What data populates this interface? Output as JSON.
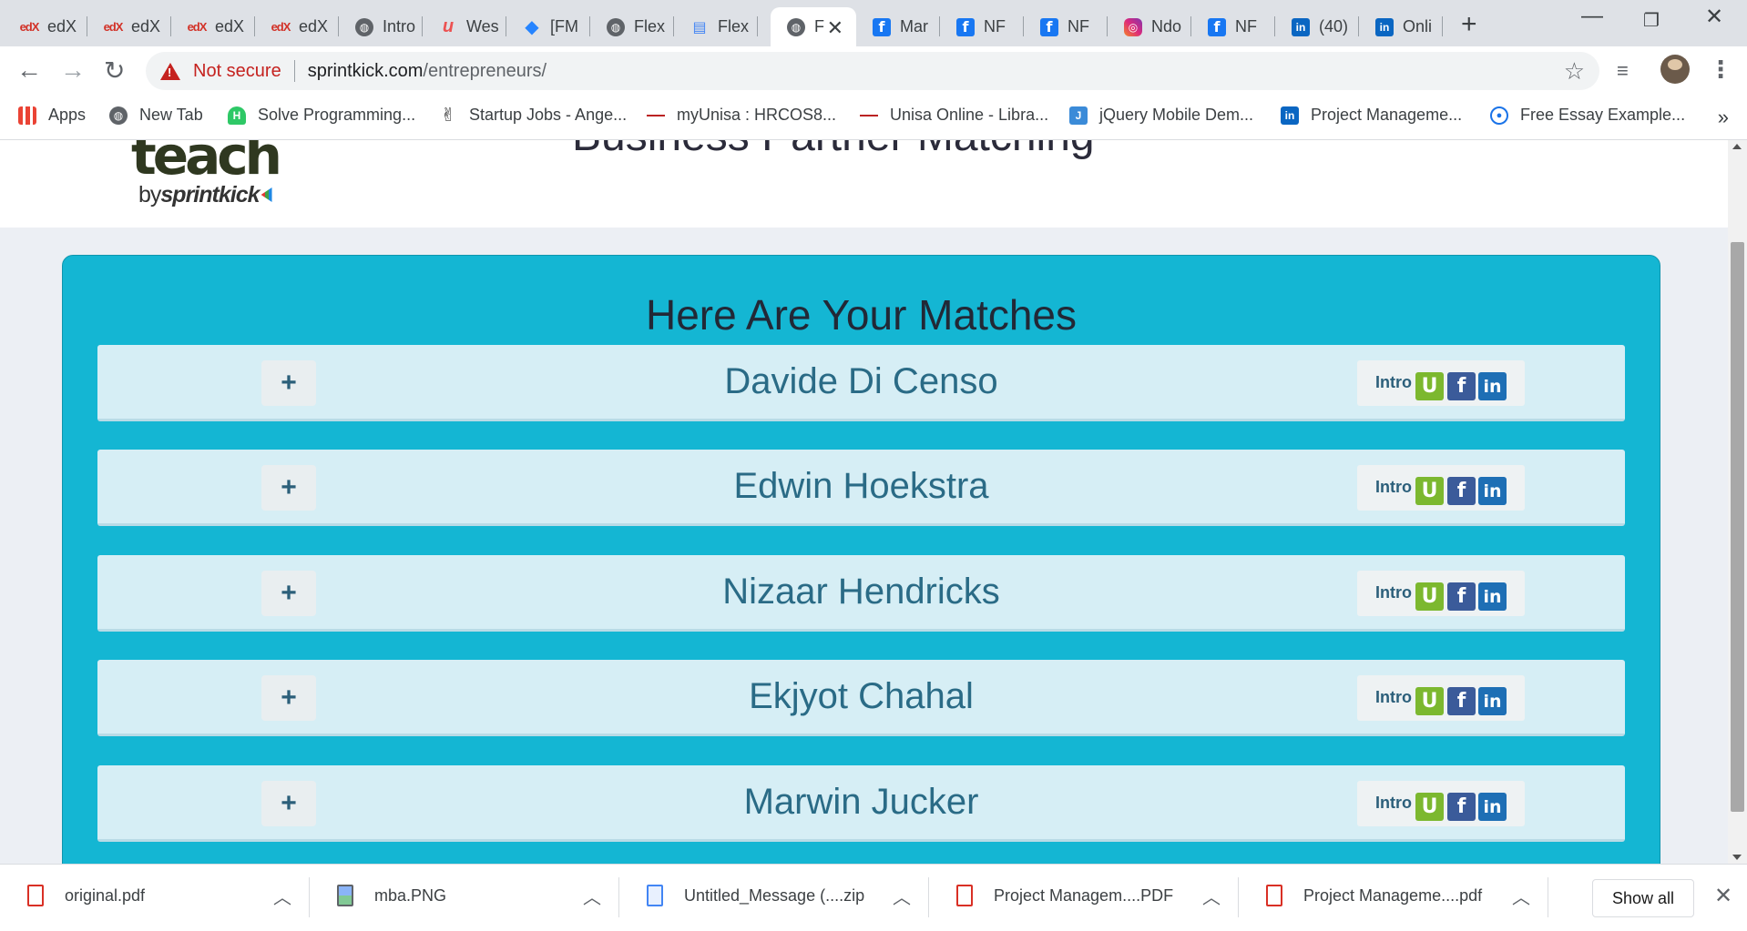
{
  "browser": {
    "tabs": [
      {
        "favicon": "edx-icon",
        "title": "edX"
      },
      {
        "favicon": "edx-icon",
        "title": "edX"
      },
      {
        "favicon": "edx-icon",
        "title": "edX"
      },
      {
        "favicon": "edx-icon",
        "title": "edX"
      },
      {
        "favicon": "globe-icon",
        "title": "Intro"
      },
      {
        "favicon": "udemy-icon",
        "title": "Wes"
      },
      {
        "favicon": "jira-icon",
        "title": "[FM"
      },
      {
        "favicon": "globe-icon",
        "title": "Flex"
      },
      {
        "favicon": "doc-icon",
        "title": "Flex"
      },
      {
        "favicon": "globe-icon",
        "title": "F",
        "active": true
      },
      {
        "favicon": "facebook-icon",
        "title": "Mar"
      },
      {
        "favicon": "facebook-icon",
        "title": "NF"
      },
      {
        "favicon": "facebook-icon",
        "title": "NF"
      },
      {
        "favicon": "instagram-icon",
        "title": "Ndo"
      },
      {
        "favicon": "facebook-icon",
        "title": "NF"
      },
      {
        "favicon": "linkedin-icon",
        "title": "(40)"
      },
      {
        "favicon": "linkedin-icon",
        "title": "Onli"
      }
    ],
    "security_label": "Not secure",
    "url_host": "sprintkick.com",
    "url_path": "/entrepreneurs/",
    "bookmarks": [
      {
        "icon": "apps-icon",
        "label": "Apps"
      },
      {
        "icon": "globe-icon",
        "label": "New Tab"
      },
      {
        "icon": "hackerrank-icon",
        "label": "Solve Programming..."
      },
      {
        "icon": "angellist-icon",
        "label": "Startup Jobs - Ange..."
      },
      {
        "icon": "unisa-icon",
        "label": "myUnisa : HRCOS8..."
      },
      {
        "icon": "unisa-icon",
        "label": "Unisa Online - Libra..."
      },
      {
        "icon": "jquery-icon",
        "label": "jQuery Mobile Dem..."
      },
      {
        "icon": "linkedin-icon",
        "label": "Project Manageme..."
      },
      {
        "icon": "bulb-icon",
        "label": "Free Essay Example..."
      }
    ],
    "bookmarks_more": "»"
  },
  "page": {
    "logo_main": "teach",
    "logo_by": "by",
    "logo_brand": "sprintkick",
    "heading": "Business Partner Matching",
    "matches_title": "Here Are Your Matches",
    "expand_label": "+",
    "intro_label": "Intro",
    "social_labels": {
      "u": "U",
      "f": "f",
      "in": "in"
    },
    "matches": [
      {
        "name": "Davide Di Censo"
      },
      {
        "name": "Edwin Hoekstra"
      },
      {
        "name": "Nizaar Hendricks"
      },
      {
        "name": "Ekjyot Chahal"
      },
      {
        "name": "Marwin Jucker"
      }
    ]
  },
  "downloads": {
    "items": [
      {
        "name": "original.pdf",
        "icon": "pdf-icon"
      },
      {
        "name": "mba.PNG",
        "icon": "image-icon"
      },
      {
        "name": "Untitled_Message (....zip",
        "icon": "zip-icon"
      },
      {
        "name": "Project Managem....PDF",
        "icon": "pdf-icon"
      },
      {
        "name": "Project Manageme....pdf",
        "icon": "pdf-icon"
      }
    ],
    "show_all": "Show all"
  }
}
